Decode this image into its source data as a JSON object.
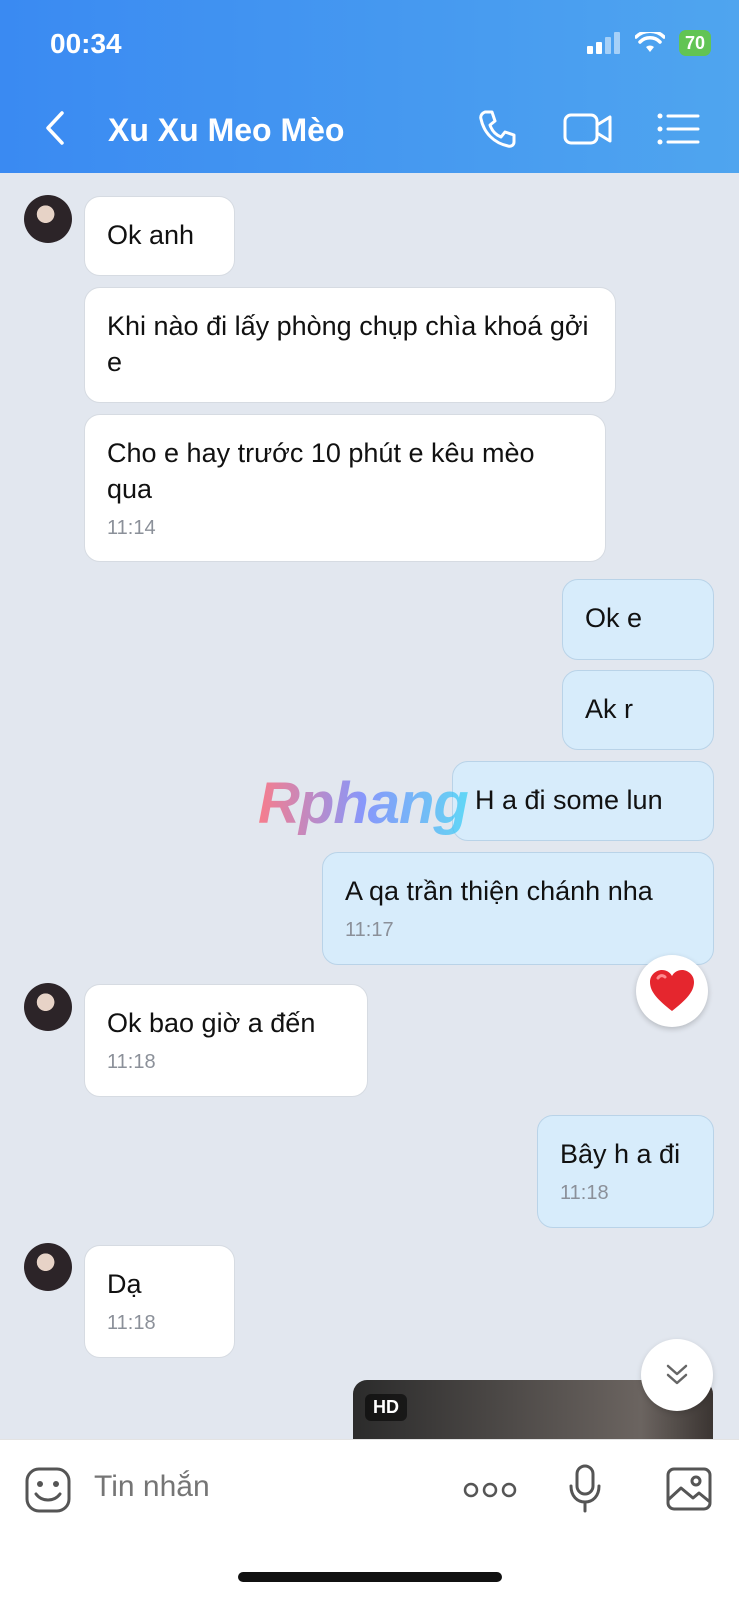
{
  "status": {
    "time": "00:34",
    "battery": "70"
  },
  "header": {
    "title": "Xu Xu Meo Mèo"
  },
  "messages": {
    "m1": {
      "text": "Ok anh"
    },
    "m2": {
      "text": "Khi nào đi lấy phòng chụp chìa khoá gởi e"
    },
    "m3": {
      "text": "Cho e hay trước 10 phút e kêu mèo qua",
      "time": "11:14"
    },
    "m4": {
      "text": "Ok e"
    },
    "m5": {
      "text": "Ak r"
    },
    "m6": {
      "text": "H a đi some lun"
    },
    "m7": {
      "text": "A qa trần thiện chánh nha",
      "time": "11:17"
    },
    "m8": {
      "text": "Ok bao giờ a đến",
      "time": "11:18"
    },
    "m9": {
      "text": "Bây h a đi",
      "time": "11:18"
    },
    "m10": {
      "text": "Dạ",
      "time": "11:18"
    }
  },
  "media": {
    "badge": "HD"
  },
  "watermark": "Rphang",
  "composer": {
    "placeholder": "Tin nhắn"
  },
  "icons": [
    "back-icon",
    "phone-icon",
    "video-icon",
    "menu-list-icon",
    "heart-reaction-icon",
    "scroll-down-icon",
    "sticker-icon",
    "more-icon",
    "mic-icon",
    "image-icon"
  ],
  "colors": {
    "header_start": "#3a8af2",
    "header_end": "#4fa5ef",
    "outgoing_bubble": "#d7ecfb",
    "incoming_bubble": "#ffffff",
    "chat_bg": "#e2e7ef"
  }
}
